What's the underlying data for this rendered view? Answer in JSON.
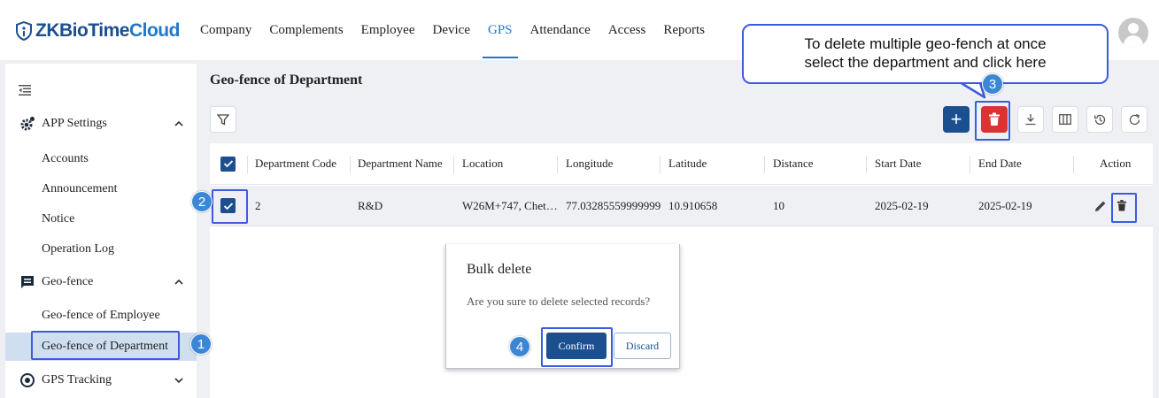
{
  "app": {
    "logo_zk": "ZKBioTime",
    "logo_cloud": "Cloud"
  },
  "nav": {
    "items": [
      "Company",
      "Complements",
      "Employee",
      "Device",
      "GPS",
      "Attendance",
      "Access",
      "Reports"
    ],
    "active": "GPS"
  },
  "sidebar": {
    "app_settings": "APP Settings",
    "app_settings_items": [
      "Accounts",
      "Announcement",
      "Notice",
      "Operation Log"
    ],
    "geo_fence": "Geo-fence",
    "geo_fence_items": [
      "Geo-fence of Employee",
      "Geo-fence of Department"
    ],
    "gps_tracking": "GPS Tracking"
  },
  "page": {
    "title": "Geo-fence of Department"
  },
  "table": {
    "columns": [
      "Department Code",
      "Department Name",
      "Location",
      "Longitude",
      "Latitude",
      "Distance",
      "Start Date",
      "End Date",
      "Action"
    ],
    "rows": [
      {
        "code": "2",
        "name": "R&D",
        "location": "W26M+747, Chet…",
        "longitude": "77.03285559999999",
        "latitude": "10.910658",
        "distance": "10",
        "start_date": "2025-02-19",
        "end_date": "2025-02-19"
      }
    ]
  },
  "dialog": {
    "title": "Bulk delete",
    "message": "Are you sure to delete selected records?",
    "confirm": "Confirm",
    "discard": "Discard"
  },
  "annotations": {
    "callout_line1": "To delete multiple geo-fench at once",
    "callout_line2": "select the department and click here",
    "steps": [
      "1",
      "2",
      "3",
      "4"
    ]
  },
  "colors": {
    "primary": "#1b4f8f",
    "accent": "#1f78c8",
    "danger": "#dc3232",
    "highlight": "#3d5be0"
  }
}
